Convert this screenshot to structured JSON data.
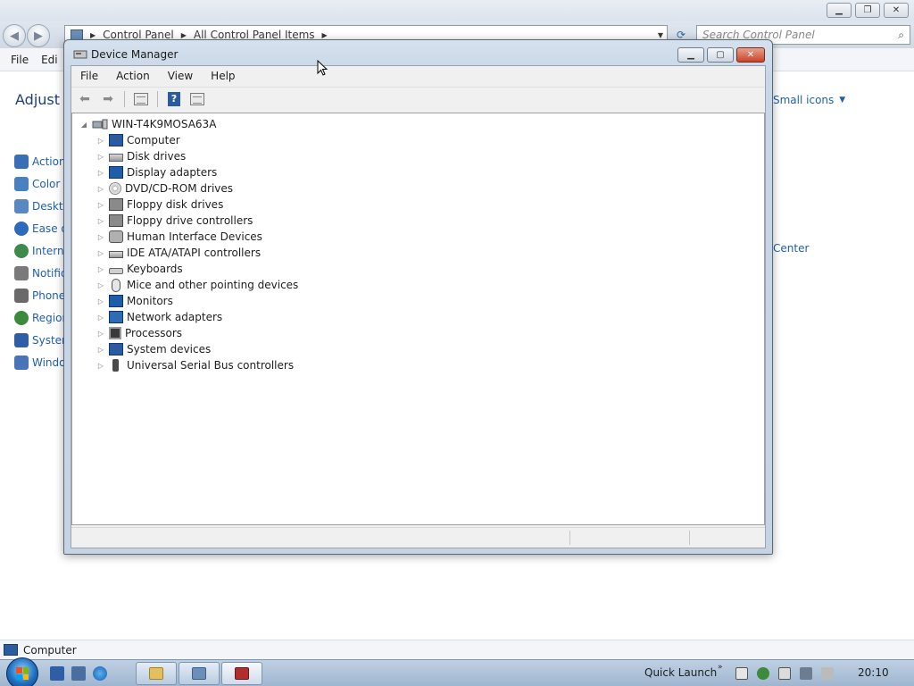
{
  "control_panel": {
    "breadcrumb": [
      "Control Panel",
      "All Control Panel Items"
    ],
    "search_placeholder": "Search Control Panel",
    "menu": [
      "File",
      "Edi"
    ],
    "heading": "Adjust y",
    "view_by": "Small icons",
    "items": [
      "Action",
      "Color I",
      "Deskto",
      "Ease o",
      "Interne",
      "Notific",
      "Phone",
      "Region",
      "System",
      "Windo"
    ],
    "right_item": "Center",
    "status_text": "Computer"
  },
  "device_manager": {
    "title": "Device Manager",
    "menu": [
      "File",
      "Action",
      "View",
      "Help"
    ],
    "root": "WIN-T4K9MOSA63A",
    "devices": [
      {
        "label": "Computer",
        "icon": "computer-icon"
      },
      {
        "label": "Disk drives",
        "icon": "disk-drive-icon"
      },
      {
        "label": "Display adapters",
        "icon": "display-adapter-icon"
      },
      {
        "label": "DVD/CD-ROM drives",
        "icon": "dvd-drive-icon"
      },
      {
        "label": "Floppy disk drives",
        "icon": "floppy-disk-icon"
      },
      {
        "label": "Floppy drive controllers",
        "icon": "floppy-controller-icon"
      },
      {
        "label": "Human Interface Devices",
        "icon": "hid-icon"
      },
      {
        "label": "IDE ATA/ATAPI controllers",
        "icon": "ide-controller-icon"
      },
      {
        "label": "Keyboards",
        "icon": "keyboard-icon"
      },
      {
        "label": "Mice and other pointing devices",
        "icon": "mouse-icon"
      },
      {
        "label": "Monitors",
        "icon": "monitor-icon"
      },
      {
        "label": "Network adapters",
        "icon": "network-adapter-icon"
      },
      {
        "label": "Processors",
        "icon": "processor-icon"
      },
      {
        "label": "System devices",
        "icon": "system-device-icon"
      },
      {
        "label": "Universal Serial Bus controllers",
        "icon": "usb-controller-icon"
      }
    ]
  },
  "taskbar": {
    "quick_launch_label": "Quick Launch",
    "clock": "20:10"
  }
}
